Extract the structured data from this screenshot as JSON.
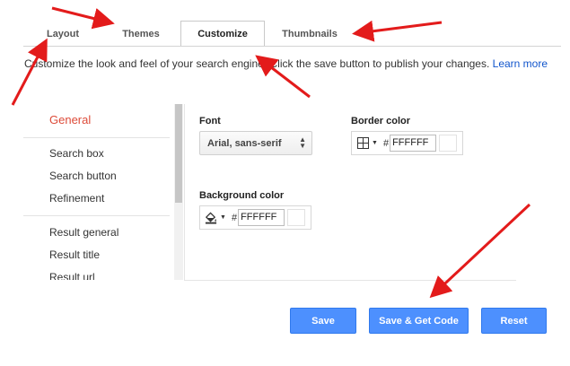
{
  "tabs": [
    {
      "label": "Layout"
    },
    {
      "label": "Themes"
    },
    {
      "label": "Customize"
    },
    {
      "label": "Thumbnails"
    }
  ],
  "description": {
    "text": "Customize the look and feel of your search engine. Click the save button to publish your changes. ",
    "link": "Learn more"
  },
  "sidebar": {
    "items": [
      {
        "label": "General"
      },
      {
        "label": "Search box"
      },
      {
        "label": "Search button"
      },
      {
        "label": "Refinement"
      },
      {
        "label": "Result general"
      },
      {
        "label": "Result title"
      },
      {
        "label": "Result url"
      }
    ]
  },
  "settings": {
    "font": {
      "label": "Font",
      "value": "Arial, sans-serif"
    },
    "border_color": {
      "label": "Border color",
      "hash": "#",
      "value": "FFFFFF"
    },
    "background_color": {
      "label": "Background color",
      "hash": "#",
      "value": "FFFFFF"
    }
  },
  "buttons": {
    "save": "Save",
    "save_get_code": "Save & Get Code",
    "reset": "Reset"
  },
  "colors": {
    "accent": "#4d90fe",
    "active_item": "#dd4b39",
    "link": "#1155cc",
    "annotation_arrows": "#e31b1b"
  },
  "icons": [
    "grid-border-icon",
    "paint-bucket-icon",
    "caret-down-icon",
    "select-arrows-icon"
  ]
}
